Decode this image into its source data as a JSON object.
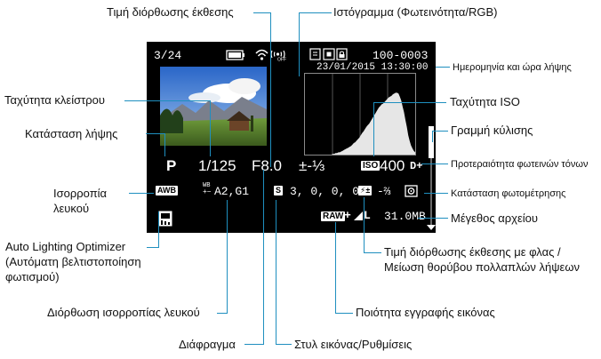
{
  "screen": {
    "image_counter": "3/24",
    "file_number": "100-0003",
    "datetime": "23/01/2015 13:30:00",
    "mode": "P",
    "shutter": "1/125",
    "aperture": "F8.0",
    "exposure_comp": "±-⅓",
    "iso_badge": "ISO",
    "iso_value": "400",
    "highlight_priority": "D+",
    "wb_badge": "AWB",
    "wb_shift_icon": "WB",
    "wb_shift": "A2,G1",
    "style_badge": "S",
    "style_settings": "3, 0, 0, 0",
    "flash_comp": "-⅔",
    "quality_raw": "RAW",
    "quality_plus": "+",
    "quality_size": "L",
    "file_size": "31.0MB"
  },
  "labels": {
    "exposure_comp": "Τιμή διόρθωσης έκθεσης",
    "histogram": "Ιστόγραμμα (Φωτεινότητα/RGB)",
    "datetime": "Ημερομηνία και ώρα λήψης",
    "shutter": "Ταχύτητα κλείστρου",
    "iso": "Ταχύτητα ISO",
    "mode": "Κατάσταση λήψης",
    "scrollbar": "Γραμμή κύλισης",
    "highlight": "Προτεραιότητα φωτεινών τόνων",
    "wb_line1": "Ισορροπία",
    "wb_line2": "λευκού",
    "metering": "Κατάσταση φωτομέτρησης",
    "filesize": "Μέγεθος αρχείου",
    "alo_line1": "Auto Lighting Optimizer",
    "alo_line2": "(Αυτόματη βελτιστοποίηση",
    "alo_line3": "φωτισμού)",
    "flash_line1": "Τιμή διόρθωσης έκθεσης με φλας /",
    "flash_line2": "Μείωση θορύβου πολλαπλών λήψεων",
    "wb_shift": "Διόρθωση ισορροπίας λευκού",
    "quality": "Ποιότητα εγγραφής εικόνας",
    "aperture": "Διάφραγμα",
    "style": "Στυλ εικόνας/Ρυθμίσεις"
  },
  "chart_data": {
    "type": "area",
    "histogram_levels": [
      0,
      0,
      0,
      0,
      0,
      0,
      0,
      0,
      0,
      0,
      0,
      0,
      0,
      0,
      0,
      0,
      0,
      0,
      0,
      0,
      1,
      1,
      2,
      2,
      3,
      3,
      4,
      5,
      6,
      7,
      8,
      9,
      10,
      11,
      13,
      15,
      16,
      18,
      20,
      22,
      25,
      28,
      30,
      33,
      36,
      38,
      40,
      43,
      46,
      49,
      52,
      55,
      58,
      61,
      63,
      65,
      66,
      68,
      70,
      72,
      74,
      75,
      76,
      78,
      79,
      80,
      80,
      79,
      75,
      70,
      62,
      55,
      45,
      36,
      25,
      18,
      12,
      8,
      5,
      3
    ],
    "colors": {
      "screen_bg": "#000000",
      "callout_line": "#1f8fbf",
      "histogram_fill": "#e6e6e6"
    }
  }
}
